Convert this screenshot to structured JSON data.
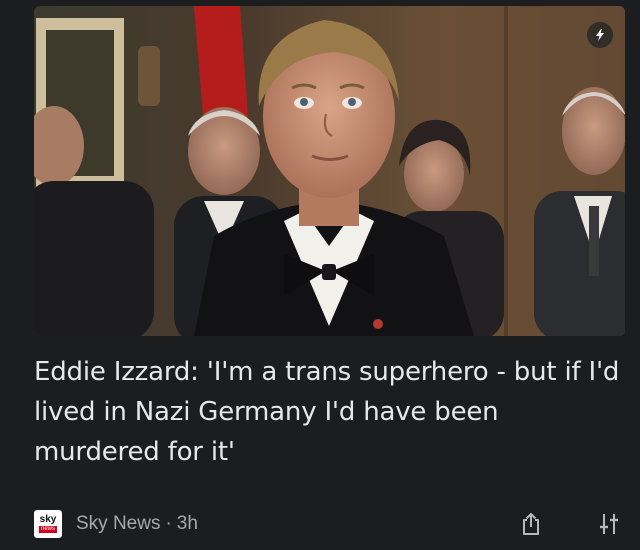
{
  "article": {
    "headline": "Eddie Izzard: 'I'm a trans superhero - but if I'd lived in Nazi Germany I'd have been murdered for it'",
    "image_icon": "lightning-bolt-icon"
  },
  "source": {
    "logo_line1": "sky",
    "logo_line2": "news",
    "name": "Sky News",
    "separator": "·",
    "time": "3h"
  },
  "actions": {
    "share_icon": "share-icon",
    "options_icon": "sliders-icon"
  },
  "colors": {
    "background": "#1c1d1f",
    "headline_text": "#e8e8e8",
    "meta_text": "#a8a8a8",
    "sky_news_red": "#d4001a"
  }
}
